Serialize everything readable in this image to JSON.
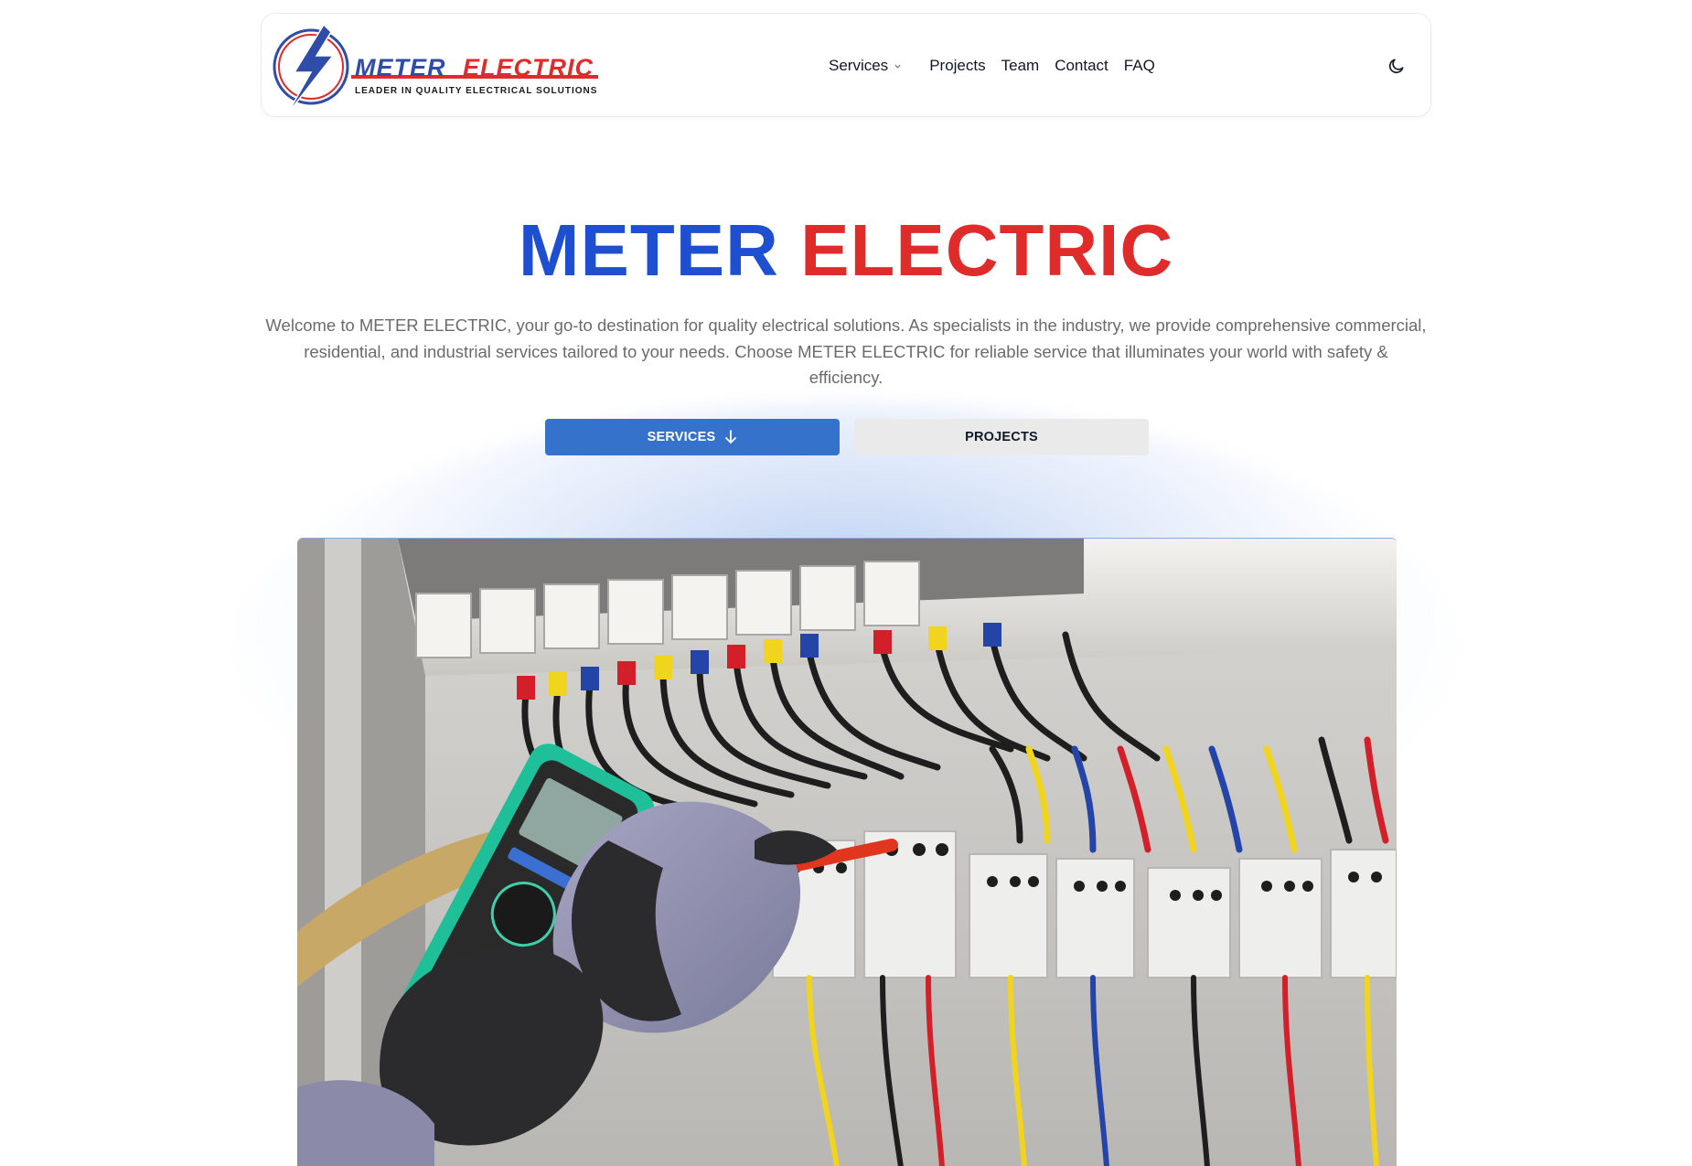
{
  "brand": {
    "logo_word1": "METER",
    "logo_word2": "ELECTRIC",
    "logo_tagline": "LEADER IN QUALITY ELECTRICAL SOLUTIONS",
    "primary_color": "#1f4fd1",
    "accent_color": "#e02b2b",
    "logo_icon": "lightning-bolt-icon"
  },
  "nav": {
    "services_label": "Services",
    "projects_label": "Projects",
    "team_label": "Team",
    "contact_label": "Contact",
    "faq_label": "FAQ",
    "theme_toggle_icon": "moon-icon"
  },
  "hero": {
    "title_part1": "METER",
    "title_part2": "ELECTRIC",
    "description": "Welcome to METER ELECTRIC, your go-to destination for quality electrical solutions. As specialists in the industry, we provide comprehensive commercial, residential, and industrial services tailored to your needs. Choose METER ELECTRIC for reliable service that illuminates your world with safety & efficiency.",
    "primary_button_label": "SERVICES",
    "primary_button_icon": "arrow-down-icon",
    "primary_button_color": "#3572cc",
    "secondary_button_label": "PROJECTS"
  }
}
